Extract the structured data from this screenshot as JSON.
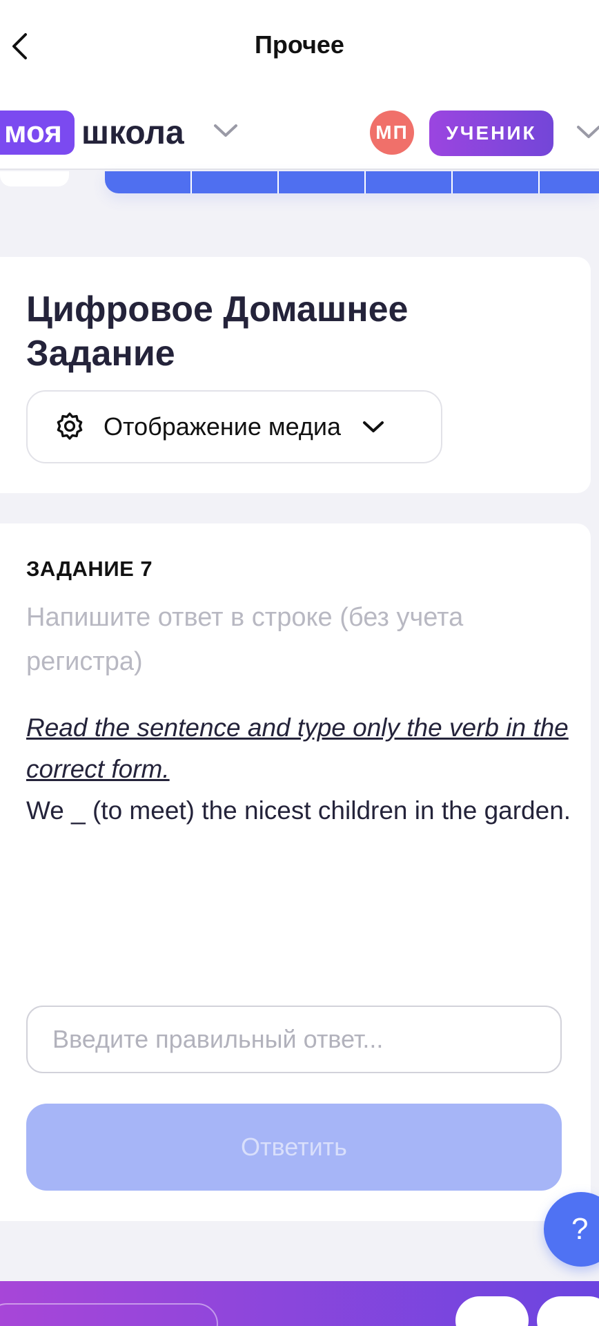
{
  "nav": {
    "title": "Прочее"
  },
  "header": {
    "logo_part1": "моя",
    "logo_part2": "школа",
    "avatar_initials": "МП",
    "role": "УЧЕНИК"
  },
  "homework": {
    "title": "Цифровое Домашнее Задание",
    "media_button_label": "Отображение медиа"
  },
  "task": {
    "number_label": "ЗАДАНИЕ 7",
    "hint": "Напишите ответ в строке (без учета регистра)",
    "instruction": "Read the sentence and type only the verb in the correct form.",
    "sentence": "We _ (to meet) the nicest children in the garden.",
    "answer_placeholder": "Введите правильный ответ...",
    "answer_value": "",
    "submit_label": "Ответить"
  },
  "help": {
    "label": "?"
  },
  "colors": {
    "brand_purple": "#7b4af0",
    "accent_blue": "#4f6ff0",
    "submit_disabled": "#a6b5f7",
    "avatar_red": "#f0706a"
  }
}
